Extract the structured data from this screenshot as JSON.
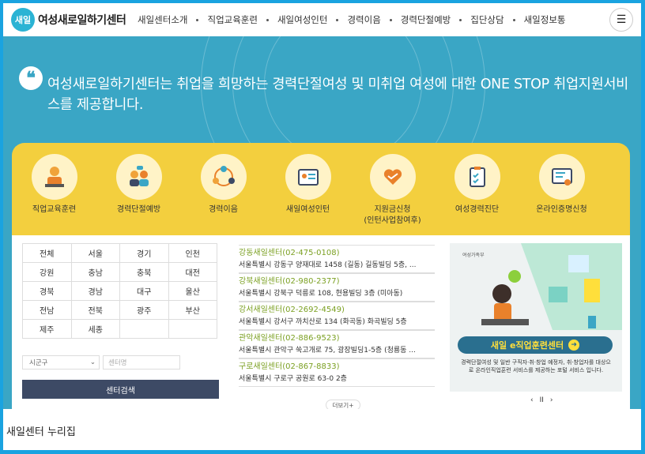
{
  "logo": {
    "badge": "새일",
    "name": "여성새로일하기센터"
  },
  "nav": [
    "새일센터소개",
    "직업교육훈련",
    "새일여성인턴",
    "경력이음",
    "경력단절예방",
    "집단상담",
    "새일정보통"
  ],
  "hero": {
    "text": "여성새로일하기센터는 취업을 희망하는 경력단절여성 및 미취업 여성에 대한 ONE STOP 취업지원서비스를 제공합니다."
  },
  "services": [
    {
      "label": "직업교육훈련",
      "icon": "teacher-icon"
    },
    {
      "label": "경력단절예방",
      "icon": "people-talk-icon"
    },
    {
      "label": "경력이음",
      "icon": "team-circle-icon"
    },
    {
      "label": "새일여성인턴",
      "icon": "id-card-icon"
    },
    {
      "label": "지원금신청\n(인턴사업참여후)",
      "icon": "heart-hand-icon"
    },
    {
      "label": "여성경력진단",
      "icon": "clipboard-check-icon"
    },
    {
      "label": "온라인증명신청",
      "icon": "certificate-icon"
    }
  ],
  "regions": [
    [
      "전체",
      "서울",
      "경기",
      "인천"
    ],
    [
      "강원",
      "충남",
      "충북",
      "대전"
    ],
    [
      "경북",
      "경남",
      "대구",
      "울산"
    ],
    [
      "전남",
      "전북",
      "광주",
      "부산"
    ],
    [
      "제주",
      "세종",
      "",
      ""
    ]
  ],
  "search": {
    "district_select": "시군구",
    "center_placeholder": "센터명",
    "button": "센터검색"
  },
  "centers": [
    {
      "name": "강동새일센터(02-475-0108)",
      "addr": "서울특별시 강동구 양재대로 1458 (길동) 길동빌딩 5층, ..."
    },
    {
      "name": "강북새일센터(02-980-2377)",
      "addr": "서울특별시 강북구 덕릉로 108, 현용빌딩 3층 (미아동)"
    },
    {
      "name": "강서새일센터(02-2692-4549)",
      "addr": "서울특별시 강서구 까치산로 134 (화곡동) 화곡빌딩 5층"
    },
    {
      "name": "관악새일센터(02-886-9523)",
      "addr": "서울특별시 관악구 쑥고개로 75, 광장빌딩1-5층 (청룡동 ..."
    },
    {
      "name": "구로새일센터(02-867-8833)",
      "addr": "서울특별시 구로구 공원로 63-0 2층"
    }
  ],
  "more": "더보기+",
  "banner": {
    "gov": "여성가족부",
    "cta": "새일 e직업훈련센터",
    "desc": "경력단절여성 및 일반 구직자·취·창업 예정자, 취·창업자를 대상으로 온라인직업훈련 서비스를 제공하는 포털 서비스 입니다.",
    "prev": "‹",
    "pause": "II",
    "next": "›"
  },
  "footer": "새일센터 누리집",
  "colors": {
    "hero": "#3aa6c5",
    "panel": "#f3cf3e",
    "accent": "#7ba022",
    "button": "#3d4a65"
  }
}
